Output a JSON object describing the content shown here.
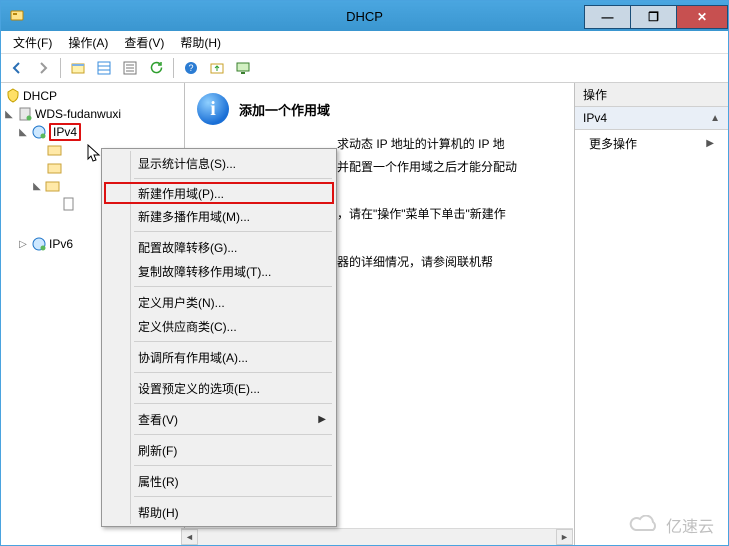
{
  "window": {
    "title": "DHCP"
  },
  "win_controls": {
    "min": "—",
    "max": "❐",
    "close": "✕"
  },
  "menubar": [
    {
      "label": "文件(F)"
    },
    {
      "label": "操作(A)"
    },
    {
      "label": "查看(V)"
    },
    {
      "label": "帮助(H)"
    }
  ],
  "tree": {
    "root": "DHCP",
    "server": "WDS-fudanwuxi",
    "ipv4": "IPv4",
    "ipv6": "IPv6"
  },
  "content": {
    "title": "添加一个作用域",
    "line1_tail": "求动态 IP 地址的计算机的 IP 地",
    "line2_tail": "并配置一个作用域之后才能分配动",
    "line3_tail": "，请在\"操作\"菜单下单击\"新建作",
    "line4_tail": "器的详细情况，请参阅联机帮"
  },
  "actions": {
    "header": "操作",
    "section": "IPv4",
    "more": "更多操作"
  },
  "context_menu": {
    "items": [
      {
        "key": "stats",
        "label": "显示统计信息(S)..."
      },
      {
        "key": "sep"
      },
      {
        "key": "new_scope",
        "label": "新建作用域(P)...",
        "highlight": true
      },
      {
        "key": "new_mcast",
        "label": "新建多播作用域(M)..."
      },
      {
        "key": "sep"
      },
      {
        "key": "cfg_fail",
        "label": "配置故障转移(G)..."
      },
      {
        "key": "rep_fail",
        "label": "复制故障转移作用域(T)..."
      },
      {
        "key": "sep"
      },
      {
        "key": "user_class",
        "label": "定义用户类(N)..."
      },
      {
        "key": "vendor_class",
        "label": "定义供应商类(C)..."
      },
      {
        "key": "sep"
      },
      {
        "key": "reconcile",
        "label": "协调所有作用域(A)..."
      },
      {
        "key": "sep"
      },
      {
        "key": "predef",
        "label": "设置预定义的选项(E)..."
      },
      {
        "key": "sep"
      },
      {
        "key": "view",
        "label": "查看(V)",
        "submenu": true
      },
      {
        "key": "sep"
      },
      {
        "key": "refresh",
        "label": "刷新(F)"
      },
      {
        "key": "sep"
      },
      {
        "key": "props",
        "label": "属性(R)"
      },
      {
        "key": "sep"
      },
      {
        "key": "help",
        "label": "帮助(H)"
      }
    ]
  },
  "watermark": "亿速云"
}
